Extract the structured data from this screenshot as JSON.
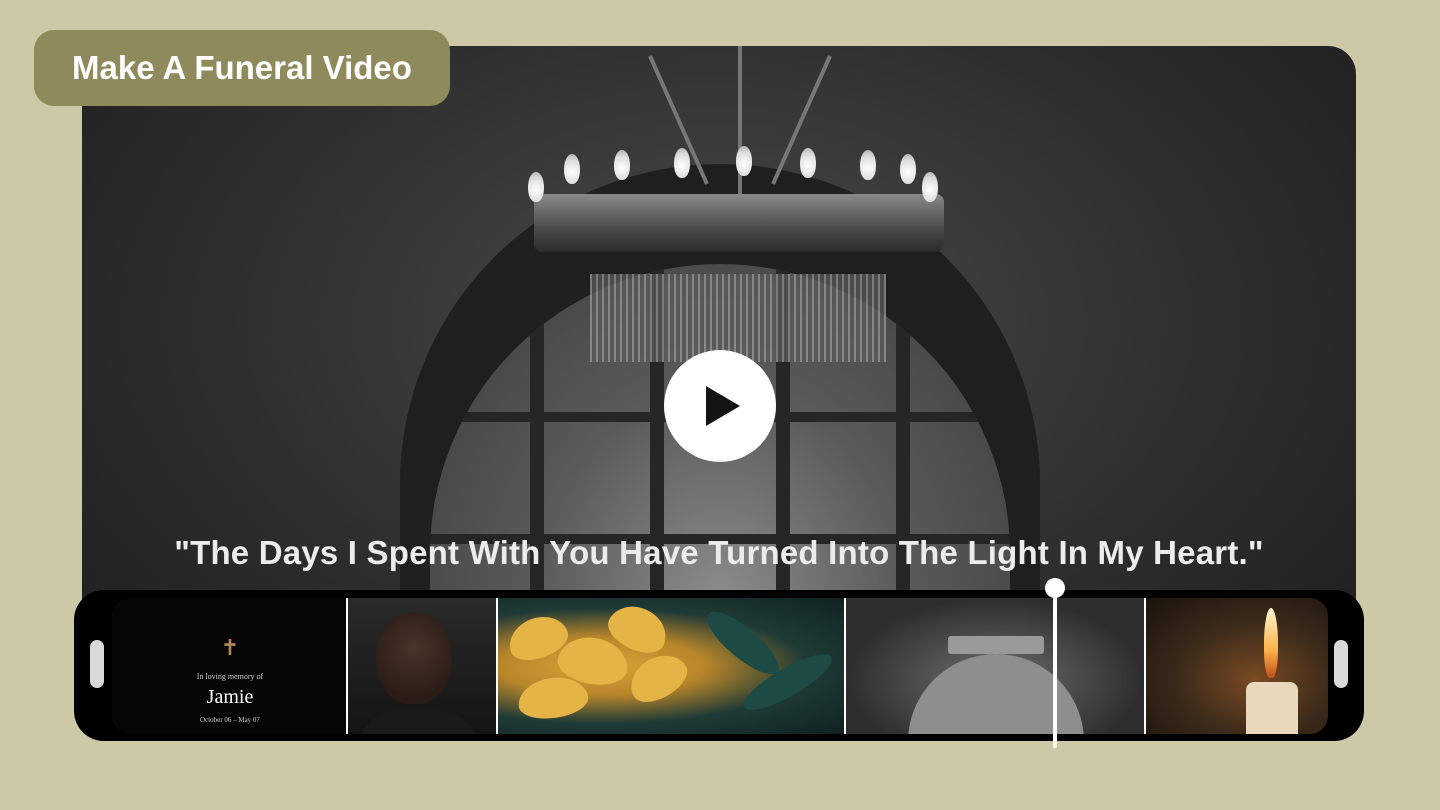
{
  "badge": {
    "title": "Make A Funeral Video"
  },
  "player": {
    "quote": "\"The Days I Spent With You Have Turned Into The Light In My Heart.\"",
    "play_icon": "play-icon"
  },
  "timeline": {
    "memorial_card": {
      "cross": "✝",
      "dedication": "In loving memory of",
      "name": "Jamie",
      "dates": "October 06 – May 07"
    },
    "clips": [
      {
        "name": "memorial-title-card"
      },
      {
        "name": "portrait-photo"
      },
      {
        "name": "yellow-flowers"
      },
      {
        "name": "chandelier-window"
      },
      {
        "name": "candle"
      }
    ]
  },
  "colors": {
    "page_background": "#cdc8a6",
    "badge_background": "#8e8a5c",
    "timeline_background": "#000000",
    "playhead": "#ffffff"
  }
}
